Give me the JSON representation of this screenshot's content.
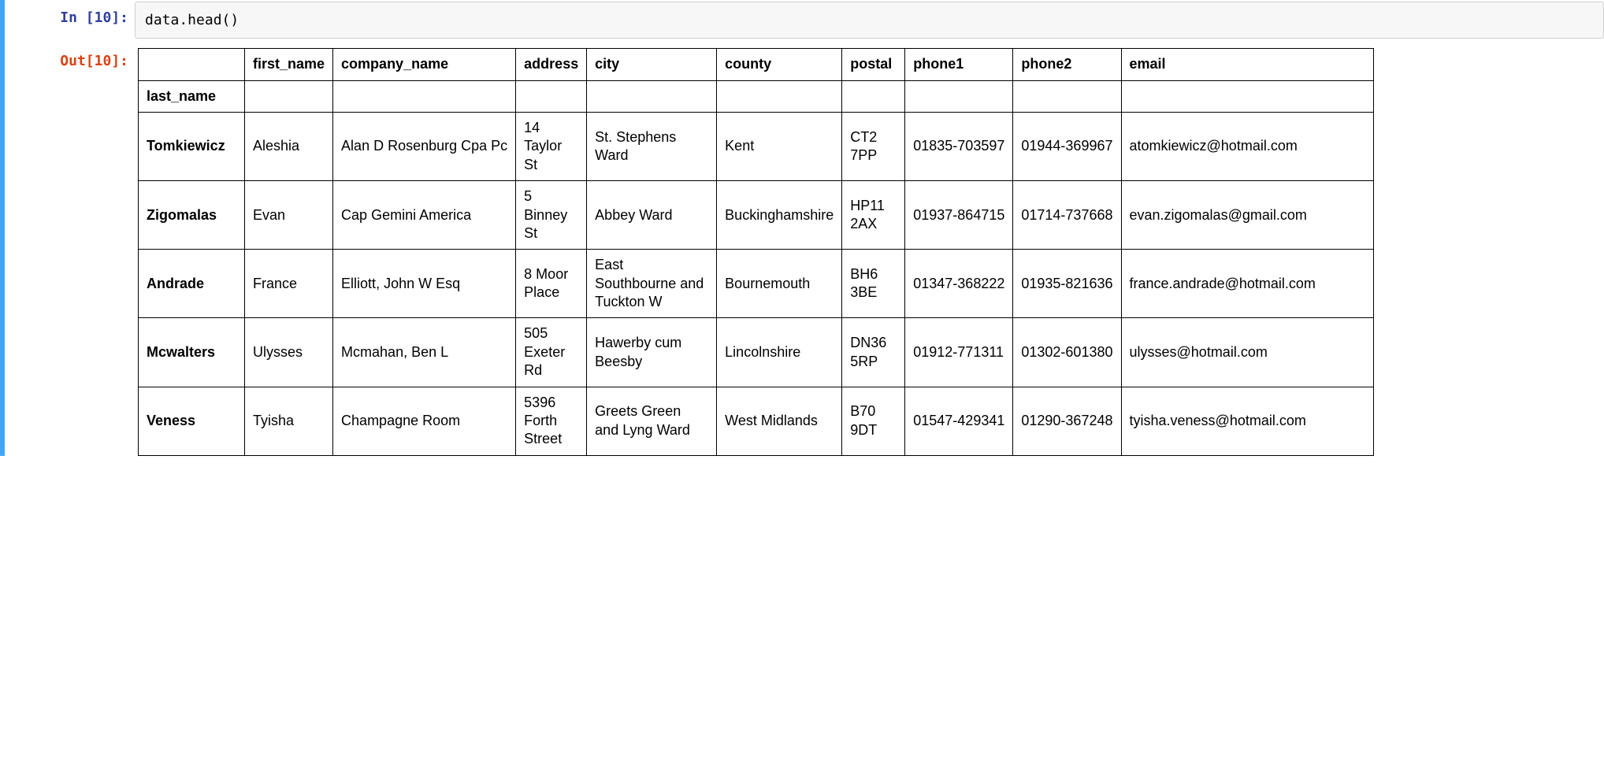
{
  "input": {
    "prompt": "In [10]:",
    "code": "data.head()"
  },
  "output": {
    "prompt": "Out[10]:",
    "dataframe": {
      "index_name": "last_name",
      "columns": [
        "first_name",
        "company_name",
        "address",
        "city",
        "county",
        "postal",
        "phone1",
        "phone2",
        "email"
      ],
      "rows": [
        {
          "index": "Tomkiewicz",
          "first_name": "Aleshia",
          "company_name": "Alan D Rosenburg Cpa Pc",
          "address": "14 Taylor St",
          "city": "St. Stephens Ward",
          "county": "Kent",
          "postal": "CT2 7PP",
          "phone1": "01835-703597",
          "phone2": "01944-369967",
          "email": "atomkiewicz@hotmail.com"
        },
        {
          "index": "Zigomalas",
          "first_name": "Evan",
          "company_name": "Cap Gemini America",
          "address": "5 Binney St",
          "city": "Abbey Ward",
          "county": "Buckinghamshire",
          "postal": "HP11 2AX",
          "phone1": "01937-864715",
          "phone2": "01714-737668",
          "email": "evan.zigomalas@gmail.com"
        },
        {
          "index": "Andrade",
          "first_name": "France",
          "company_name": "Elliott, John W Esq",
          "address": "8 Moor Place",
          "city": "East Southbourne and Tuckton W",
          "county": "Bournemouth",
          "postal": "BH6 3BE",
          "phone1": "01347-368222",
          "phone2": "01935-821636",
          "email": "france.andrade@hotmail.com"
        },
        {
          "index": "Mcwalters",
          "first_name": "Ulysses",
          "company_name": "Mcmahan, Ben L",
          "address": "505 Exeter Rd",
          "city": "Hawerby cum Beesby",
          "county": "Lincolnshire",
          "postal": "DN36 5RP",
          "phone1": "01912-771311",
          "phone2": "01302-601380",
          "email": "ulysses@hotmail.com"
        },
        {
          "index": "Veness",
          "first_name": "Tyisha",
          "company_name": "Champagne Room",
          "address": "5396 Forth Street",
          "city": "Greets Green and Lyng Ward",
          "county": "West Midlands",
          "postal": "B70 9DT",
          "phone1": "01547-429341",
          "phone2": "01290-367248",
          "email": "tyisha.veness@hotmail.com"
        }
      ]
    }
  }
}
